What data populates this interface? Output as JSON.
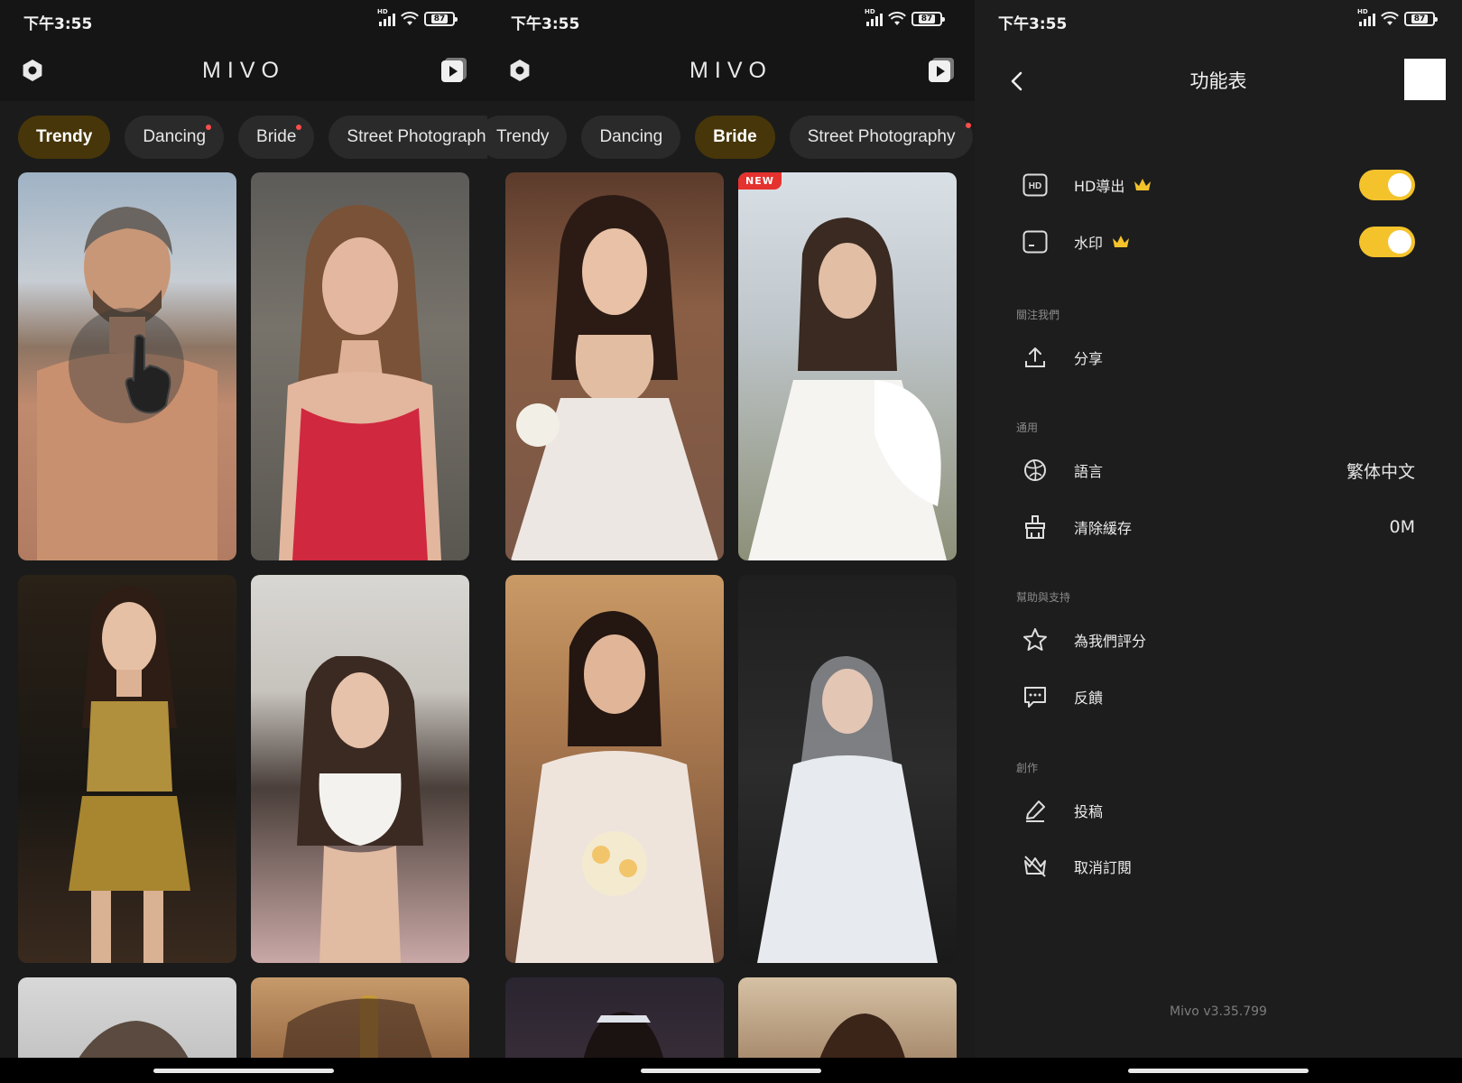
{
  "status": {
    "time": "下午3:55",
    "battery": "87"
  },
  "app": {
    "brand": "MIVO"
  },
  "screen1": {
    "tabs": [
      {
        "label": "Trendy",
        "active": true,
        "dot": false
      },
      {
        "label": "Dancing",
        "active": false,
        "dot": true
      },
      {
        "label": "Bride",
        "active": false,
        "dot": true
      },
      {
        "label": "Street Photograph",
        "active": false,
        "dot": false
      }
    ]
  },
  "screen2": {
    "tabs": [
      {
        "label": "Trendy",
        "active": false,
        "dot": false
      },
      {
        "label": "Dancing",
        "active": false,
        "dot": false
      },
      {
        "label": "Bride",
        "active": true,
        "dot": false
      },
      {
        "label": "Street Photography",
        "active": false,
        "dot": true
      }
    ],
    "new_badge": "NEW"
  },
  "settings": {
    "title": "功能表",
    "hd_export": "HD導出",
    "watermark": "水印",
    "section_follow": "關注我們",
    "share": "分享",
    "section_general": "通用",
    "language": "語言",
    "language_value": "繁体中文",
    "clear_cache": "清除緩存",
    "cache_value": "0M",
    "section_help": "幫助與支持",
    "rate": "為我們評分",
    "feedback": "反饋",
    "section_create": "創作",
    "submit": "投稿",
    "unsubscribe": "取消訂閱",
    "version": "Mivo v3.35.799",
    "hd_toggle_on": true,
    "watermark_toggle_on": true
  },
  "colors": {
    "accent": "#f4c32b",
    "active_tab": "#473609",
    "badge": "#e5322e"
  }
}
